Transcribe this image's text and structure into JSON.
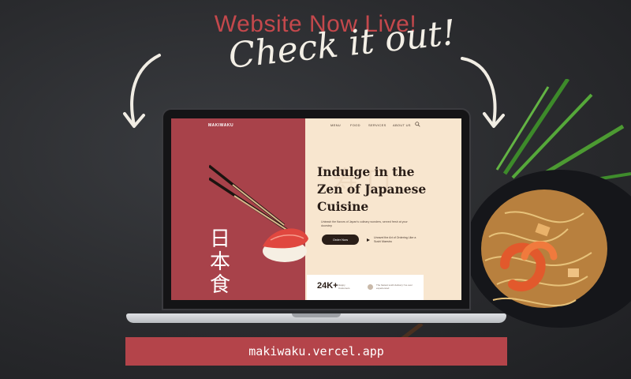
{
  "promo": {
    "headline": "Website Now Live!",
    "tagline": "Check it out!",
    "url": "makiwaku.vercel.app"
  },
  "site": {
    "logo": "MAKIWAKU",
    "nav": [
      "MENU",
      "FOOD",
      "SERVICES",
      "ABOUT US"
    ],
    "hero_title_lines": [
      "Indulge in the",
      "Zen of Japanese",
      "Cuisine"
    ],
    "hero_sub": "Unleash the flavors of Japan's culinary wonders, served fresh at your doorstep",
    "order_button": "Order Now",
    "story_text": "Unravel the Art of Ordering Like a Sushi Maestro",
    "stat_number": "24K+",
    "stat_label": "Happy Customers",
    "review_text": "The fastest sushi delivery I've ever experienced",
    "kanji": [
      "日",
      "本",
      "食"
    ]
  },
  "colors": {
    "accent": "#b4444a",
    "headline": "#c4484c",
    "site_bg": "#f8e6cf",
    "site_side": "#a8424a"
  }
}
